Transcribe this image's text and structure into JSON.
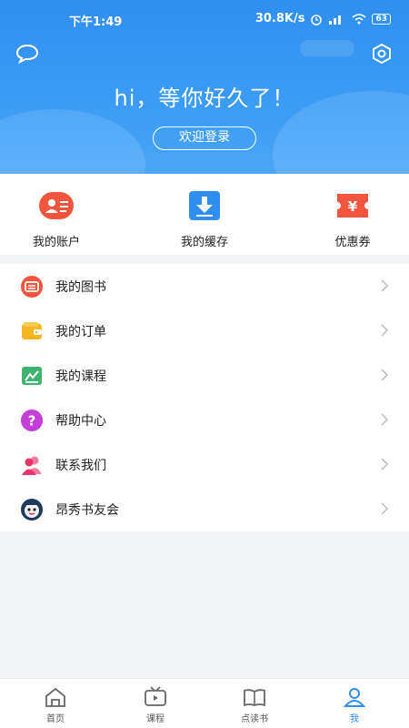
{
  "status_bar": {
    "time": "下午1:49",
    "speed": "30.8K/s",
    "battery": "63"
  },
  "header": {
    "greeting": "hi，等你好久了！",
    "login_label": "欢迎登录"
  },
  "quick_actions": [
    {
      "label": "我的账户",
      "icon": "account-card-icon",
      "color": "#f2553d"
    },
    {
      "label": "我的缓存",
      "icon": "download-icon",
      "color": "#2f8ff0"
    },
    {
      "label": "优惠券",
      "icon": "coupon-icon",
      "color": "#f2553d"
    }
  ],
  "menu": [
    {
      "label": "我的图书",
      "icon": "book-icon"
    },
    {
      "label": "我的订单",
      "icon": "wallet-icon"
    },
    {
      "label": "我的课程",
      "icon": "course-icon"
    },
    {
      "label": "帮助中心",
      "icon": "help-icon"
    },
    {
      "label": "联系我们",
      "icon": "contacts-icon"
    },
    {
      "label": "昂秀书友会",
      "icon": "club-avatar-icon"
    }
  ],
  "bottom_nav": [
    {
      "label": "首页",
      "icon": "home-icon",
      "active": false
    },
    {
      "label": "课程",
      "icon": "tv-icon",
      "active": false
    },
    {
      "label": "点读书",
      "icon": "open-book-icon",
      "active": false
    },
    {
      "label": "我",
      "icon": "user-icon",
      "active": true
    }
  ],
  "colors": {
    "brand_blue": "#2f8ff0",
    "accent_red": "#f2553d"
  }
}
